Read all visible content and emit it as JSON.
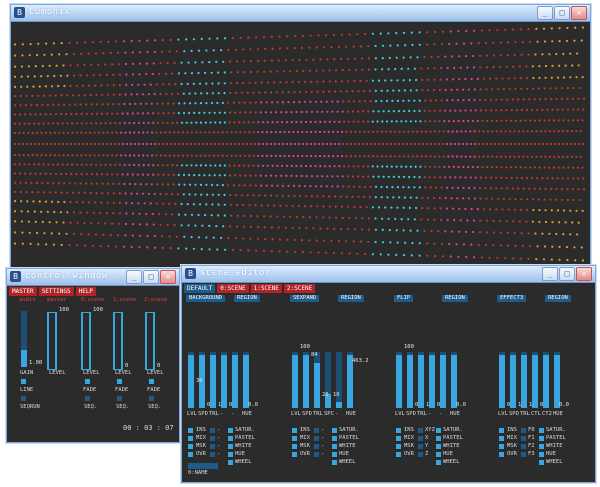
{
  "main_window": {
    "title": "Lumonix",
    "icon": "app-icon"
  },
  "controls_window": {
    "title": "control window",
    "tabs": [
      "MASTER",
      "SETTINGS",
      "HELP"
    ],
    "column_headers": [
      "audio",
      "master",
      "0:scene",
      "1:scene",
      "2:scene"
    ],
    "slider_values": [
      "100",
      "100",
      "0",
      "0"
    ],
    "gain_value": "1.00",
    "labels": {
      "gain": "GAIN",
      "level": "LEVEL",
      "line": "LINE",
      "seqrun": "SEQRUN",
      "fade": "FADE",
      "seq": "SEQ."
    },
    "timer": "00 : 03 : 07"
  },
  "scene_window": {
    "title": "scene editor",
    "tabs": [
      "DEFAULT",
      "0:SCENE",
      "1:SCENE",
      "2:SCENE"
    ],
    "groups": [
      {
        "name": "BACKGROUND",
        "region": "REGION",
        "slider_labels": [
          "LVL",
          "SPD",
          "TRL",
          "-",
          "-",
          "HUE"
        ],
        "values": [
          "30",
          "0",
          "1",
          "0",
          "0.0"
        ],
        "checks": [
          "INS",
          "MIX",
          "MSK",
          "OVR"
        ],
        "side_checks": [
          "-",
          "-",
          "-",
          "-"
        ],
        "right_checks": [
          "SATUR.",
          "PASTEL",
          "WHITE",
          "HUE",
          "WHEEL"
        ],
        "name_field": "0:NAME"
      },
      {
        "name": "SEXPAND",
        "region": "REGION",
        "slider_labels": [
          "LVL",
          "SPD",
          "TRL",
          "SPC",
          "-",
          "HUE"
        ],
        "values": [
          "100",
          "84",
          "20",
          "10",
          "463.2"
        ],
        "checks": [
          "INS",
          "MIX",
          "MSK",
          "OVR"
        ],
        "side_checks": [
          "-",
          "-",
          "-",
          "-"
        ],
        "right_checks": [
          "SATUR.",
          "PASTEL",
          "WHITE",
          "HUE",
          "WHEEL"
        ]
      },
      {
        "name": "FLIP",
        "region": "REGION",
        "slider_labels": [
          "LVL",
          "SPD",
          "TRL",
          "-",
          "-",
          "HUE"
        ],
        "values": [
          "100",
          "0",
          "1",
          "0",
          "0.0"
        ],
        "checks": [
          "INS",
          "MIX",
          "MSK",
          "OVR"
        ],
        "side_checks": [
          "XYZ",
          "X",
          "Y",
          "Z"
        ],
        "right_checks": [
          "SATUR.",
          "PASTEL",
          "WHITE",
          "HUE",
          "WHEEL"
        ]
      },
      {
        "name": "EFFECT3",
        "region": "REGION",
        "slider_labels": [
          "LVL",
          "SPD",
          "TRL",
          "CTL",
          "CT2",
          "HUE"
        ],
        "values": [
          "0",
          "1",
          "1",
          "0",
          "0.0"
        ],
        "checks": [
          "INS",
          "MIX",
          "MSK",
          "OVR"
        ],
        "side_checks": [
          "F0",
          "F1",
          "F2",
          "F3"
        ],
        "right_checks": [
          "SATUR.",
          "PASTEL",
          "WHITE",
          "HUE",
          "WHEEL"
        ]
      }
    ]
  },
  "colors": {
    "background": "#2b2b2b",
    "accent": "#38a6e0",
    "tab_red": "#b02428",
    "dot_red": "#c0392b",
    "dot_magenta": "#e0409a",
    "dot_cyan": "#3fd0e0",
    "dot_orange": "#e0a030"
  }
}
